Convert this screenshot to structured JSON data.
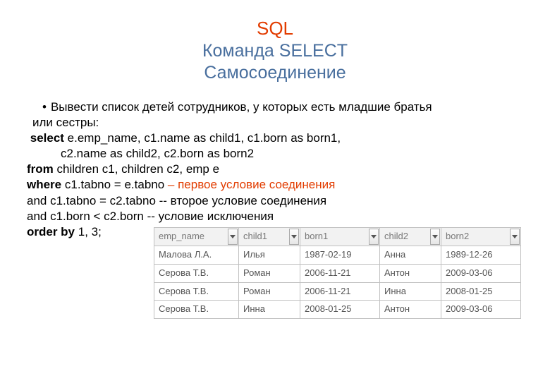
{
  "title": {
    "main": "SQL",
    "sub1": "Команда SELECT",
    "sub2": "Самосоединение"
  },
  "bullet": {
    "line1": "Вывести список детей сотрудников, у которых есть младшие братья",
    "line2": "или сестры:"
  },
  "code": {
    "l1a": "select",
    "l1b": " e.emp_name, c1.name as child1, c1.born as born1,",
    "l2": "c2.name as  child2, c2.born as born2",
    "l3a": "from",
    "l3b": " children c1, children c2, emp e",
    "l4a": "where",
    "l4b": " c1.tabno = e.tabno ",
    "l4c": "– первое условие соединения",
    "l5": "  and c1.tabno = c2.tabno -- второе условие соединения",
    "l6": "  and c1.born < c2.born   -- условие исключения",
    "l7a": "order by",
    "l7b": " 1, 3;"
  },
  "table": {
    "headers": [
      "emp_name",
      "child1",
      "born1",
      "child2",
      "born2"
    ],
    "rows": [
      [
        "Малова Л.А.",
        "Илья",
        "1987-02-19",
        "Анна",
        "1989-12-26"
      ],
      [
        "Серова Т.В.",
        "Роман",
        "2006-11-21",
        "Антон",
        "2009-03-06"
      ],
      [
        "Серова Т.В.",
        "Роман",
        "2006-11-21",
        "Инна",
        "2008-01-25"
      ],
      [
        "Серова Т.В.",
        "Инна",
        "2008-01-25",
        "Антон",
        "2009-03-06"
      ]
    ]
  }
}
